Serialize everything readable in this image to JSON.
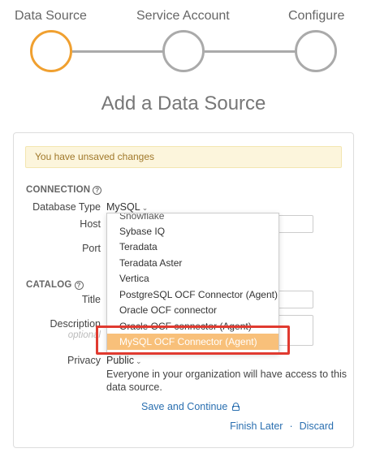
{
  "stepper": {
    "steps": [
      {
        "label": "Data Source",
        "state": "active"
      },
      {
        "label": "Service Account",
        "state": "pending"
      },
      {
        "label": "Configure",
        "state": "pending"
      }
    ],
    "active_color": "#f0a030"
  },
  "page": {
    "title": "Add a Data Source"
  },
  "alert": {
    "text": "You have unsaved changes"
  },
  "connection": {
    "section_label": "CONNECTION",
    "database_type_label": "Database Type",
    "database_type_value": "MySQL",
    "host_label": "Host",
    "port_label": "Port"
  },
  "catalog": {
    "section_label": "CATALOG",
    "title_label": "Title",
    "description_label": "Description",
    "description_hint": "optional",
    "privacy_label": "Privacy",
    "privacy_value": "Public",
    "privacy_description": "Everyone in your organization will have access to this data source."
  },
  "actions": {
    "save_label": "Save and Continue",
    "finish_later_label": "Finish Later",
    "separator": "·",
    "discard_label": "Discard"
  },
  "dropdown": {
    "items": [
      {
        "label": "Snowflake",
        "clipped": true
      },
      {
        "label": "Sybase IQ"
      },
      {
        "label": "Teradata"
      },
      {
        "label": "Teradata Aster"
      },
      {
        "label": "Vertica"
      },
      {
        "label": "PostgreSQL OCF Connector (Agent)"
      },
      {
        "label": "Oracle OCF connector"
      },
      {
        "label": "Oracle OCF connector (Agent)"
      },
      {
        "label": "MySQL OCF Connector (Agent)",
        "selected": true
      }
    ],
    "selected_color": "#f8c07a"
  },
  "annotation": {
    "highlight_color": "#e03a30"
  }
}
